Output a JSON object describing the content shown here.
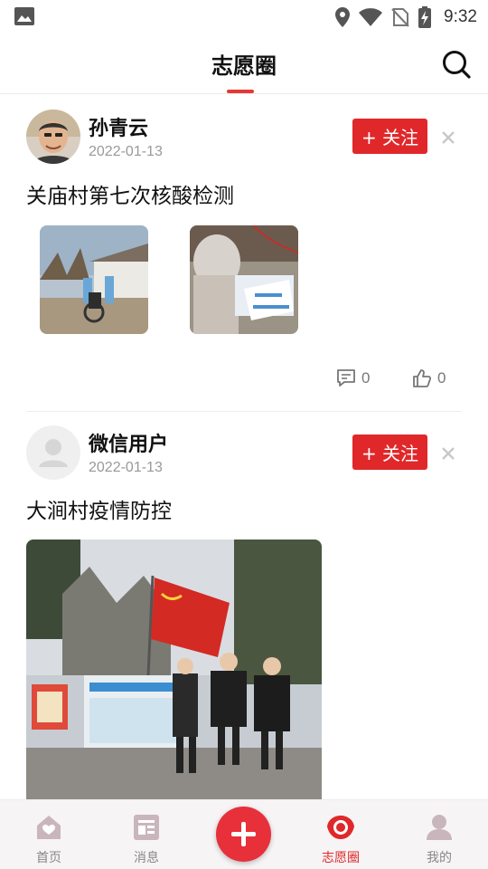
{
  "status_bar": {
    "time": "9:32"
  },
  "header": {
    "title": "志愿圈"
  },
  "posts": [
    {
      "username": "孙青云",
      "date": "2022-01-13",
      "follow_label": "+ 关注",
      "content": "关庙村第七次核酸检测",
      "comments": "0",
      "likes": "0"
    },
    {
      "username": "微信用户",
      "date": "2022-01-13",
      "follow_label": "+ 关注",
      "content": "大涧村疫情防控"
    }
  ],
  "nav": {
    "home": "首页",
    "messages": "消息",
    "volunteer": "志愿圈",
    "mine": "我的"
  },
  "colors": {
    "accent": "#e0282a",
    "muted": "#999999"
  }
}
